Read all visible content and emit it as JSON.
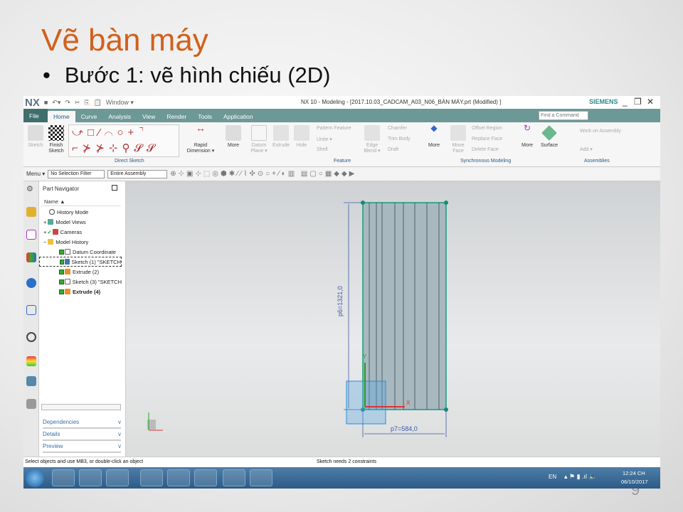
{
  "slide": {
    "title": "Vẽ bàn máy",
    "bullet": "•",
    "bullet_text": "Bước 1: vẽ hình chiếu (2D)",
    "page_number": "9"
  },
  "app": {
    "logo": "NX",
    "quick_window": "Window ▾",
    "title": "NX 10 - Modeling - [2017.10.03_CADCAM_A03_N06_BÀN MÁY.prt (Modified) ]",
    "brand": "SIEMENS",
    "find_placeholder": "Find a Command"
  },
  "tabs": [
    "File",
    "Home",
    "Curve",
    "Analysis",
    "View",
    "Render",
    "Tools",
    "Application"
  ],
  "ribbon": {
    "sketch": "Sketch",
    "finish_sketch": "Finish Sketch",
    "direct_sketch": "Direct Sketch",
    "rapid_dimension": "Rapid Dimension ▾",
    "more1": "More",
    "datum_plane": "Datum Plane ▾",
    "extrude": "Extrude",
    "hole": "Hole",
    "pattern_feature": "Pattern Feature",
    "unite": "Unite ▾",
    "shell": "Shell",
    "edge_blend": "Edge Blend ▾",
    "chamfer": "Chamfer",
    "trim_body": "Trim Body",
    "draft": "Draft",
    "more2": "More",
    "feature": "Feature",
    "move_face": "Move Face",
    "offset_region": "Offset Region",
    "replace_face": "Replace Face",
    "delete_face": "Delete Face",
    "more3": "More",
    "synchronous_modeling": "Synchronous Modeling",
    "surface": "Surface",
    "work_on_assembly": "Work on Assembly",
    "add": "Add ▾",
    "assemblies": "Assemblies"
  },
  "toolbar": {
    "menu": "Menu ▾",
    "selection_filter": "No Selection Filter",
    "assembly_scope": "Entire Assembly"
  },
  "navigator": {
    "title": "Part Navigator",
    "column": "Name ▲",
    "items": [
      {
        "label": "History Mode"
      },
      {
        "label": "Model Views"
      },
      {
        "label": "Cameras"
      },
      {
        "label": "Model History"
      },
      {
        "label": "Datum Coordinate"
      },
      {
        "label": "Sketch (1) \"SKETCH"
      },
      {
        "label": "Extrude (2)"
      },
      {
        "label": "Sketch (3) \"SKETCH"
      },
      {
        "label": "Extrude (4)"
      }
    ],
    "panels": [
      "Dependencies",
      "Details",
      "Preview"
    ]
  },
  "viewport": {
    "dim_height": "p6=1321,0",
    "dim_width": "p7=584,0",
    "axis_x": "X",
    "axis_y": "Y",
    "colors": {
      "sketch": "#1a9a7a",
      "dimension": "#3a5aa8"
    }
  },
  "status": {
    "left": "Select objects and use MB3, or double-click an object",
    "center": "Sketch needs 2 constraints"
  },
  "taskbar": {
    "lang": "EN",
    "time": "12:24 CH",
    "date": "06/10/2017"
  }
}
